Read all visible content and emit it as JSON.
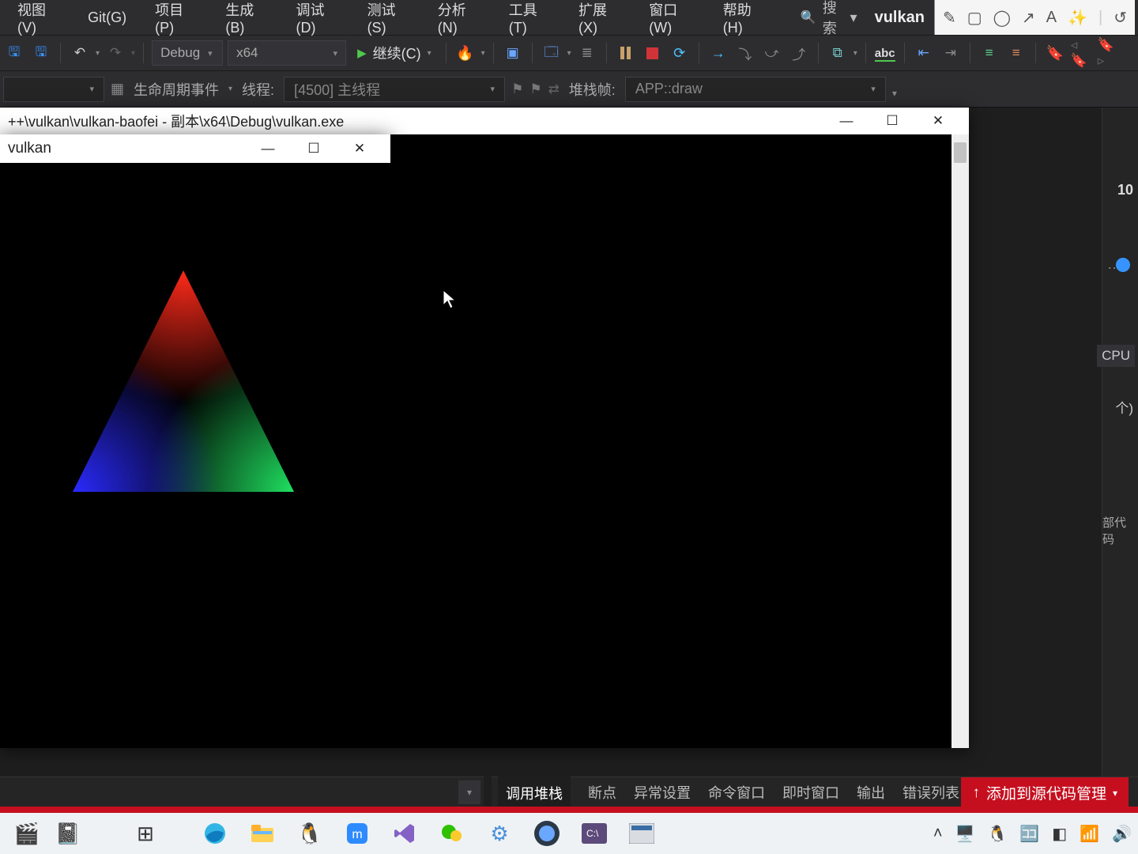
{
  "menu": {
    "items": [
      "视图(V)",
      "Git(G)",
      "项目(P)",
      "生成(B)",
      "调试(D)",
      "测试(S)",
      "分析(N)",
      "工具(T)",
      "扩展(X)",
      "窗口(W)",
      "帮助(H)"
    ],
    "search_label": "搜索",
    "app_name": "vulkan"
  },
  "toolbar": {
    "config": "Debug",
    "platform": "x64",
    "continue_label": "继续(C)"
  },
  "toolbar2": {
    "lifecycle_label": "生命周期事件",
    "thread_label": "线程:",
    "thread_value": "[4500] 主线程",
    "stackframe_label": "堆栈帧:",
    "stackframe_value": "APP::draw"
  },
  "exe_window": {
    "title": "++\\vulkan\\vulkan-baofei - 副本\\x64\\Debug\\vulkan.exe"
  },
  "vk_window": {
    "title": "vulkan"
  },
  "right": {
    "num": "10",
    "cpu": "CPU",
    "count": "个)",
    "code": "部代码"
  },
  "lower_tabs": [
    "调用堆栈",
    "断点",
    "异常设置",
    "命令窗口",
    "即时窗口",
    "输出",
    "错误列表"
  ],
  "lower_active": 0,
  "left_line": "1",
  "add_src": "添加到源代码管理",
  "triangle": {
    "top_color": "#ff2a1a",
    "left_color": "#2a2aff",
    "right_color": "#20e060"
  }
}
